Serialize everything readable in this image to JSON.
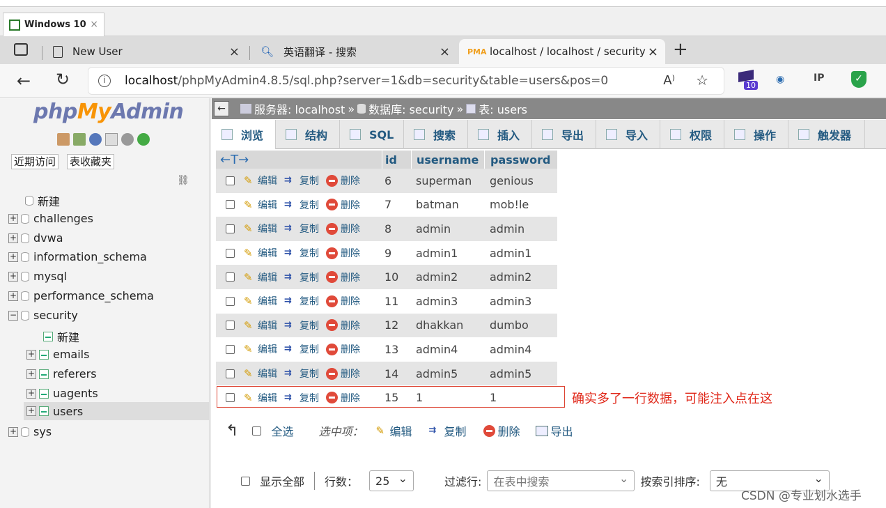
{
  "vm": {
    "tab_title": "Windows 10",
    "close": "×"
  },
  "browser": {
    "tabs": [
      {
        "title": "New User"
      },
      {
        "title": "英语翻译 - 搜索"
      },
      {
        "title": "localhost / localhost / security / u"
      }
    ],
    "new_tab": "+",
    "close_glyph": "×",
    "url_host": "localhost",
    "url_path": "/phpMyAdmin4.8.5/sql.php?server=1&db=security&table=users&pos=0",
    "ext_badge": "10",
    "ext_ip": "IP"
  },
  "nav": {
    "logo_php": "php",
    "logo_my": "My",
    "logo_admin": "Admin",
    "recent_btn": "近期访问",
    "fav_btn": "表收藏夹",
    "tree": [
      {
        "label": "新建",
        "level": 0
      },
      {
        "label": "challenges",
        "level": 0
      },
      {
        "label": "dvwa",
        "level": 0
      },
      {
        "label": "information_schema",
        "level": 0
      },
      {
        "label": "mysql",
        "level": 0
      },
      {
        "label": "performance_schema",
        "level": 0
      },
      {
        "label": "security",
        "level": 0
      },
      {
        "label": "新建",
        "level": 1
      },
      {
        "label": "emails",
        "level": 1
      },
      {
        "label": "referers",
        "level": 1
      },
      {
        "label": "uagents",
        "level": 1
      },
      {
        "label": "users",
        "level": 1
      },
      {
        "label": "sys",
        "level": 0
      }
    ]
  },
  "breadcrumb": {
    "server": "服务器: localhost",
    "sep": "»",
    "database": "数据库: security",
    "table": "表: users"
  },
  "menu": [
    "浏览",
    "结构",
    "SQL",
    "搜索",
    "插入",
    "导出",
    "导入",
    "权限",
    "操作",
    "触发器"
  ],
  "grid": {
    "arrows": "←T→",
    "columns": [
      "id",
      "username",
      "password"
    ],
    "actions": {
      "edit": "编辑",
      "copy": "复制",
      "delete": "删除"
    },
    "rows": [
      {
        "id": "6",
        "username": "superman",
        "password": "genious"
      },
      {
        "id": "7",
        "username": "batman",
        "password": "mob!le"
      },
      {
        "id": "8",
        "username": "admin",
        "password": "admin"
      },
      {
        "id": "9",
        "username": "admin1",
        "password": "admin1"
      },
      {
        "id": "10",
        "username": "admin2",
        "password": "admin2"
      },
      {
        "id": "11",
        "username": "admin3",
        "password": "admin3"
      },
      {
        "id": "12",
        "username": "dhakkan",
        "password": "dumbo"
      },
      {
        "id": "13",
        "username": "admin4",
        "password": "admin4"
      },
      {
        "id": "14",
        "username": "admin5",
        "password": "admin5"
      },
      {
        "id": "15",
        "username": "1",
        "password": "1"
      }
    ]
  },
  "annotation": "确实多了一行数据，可能注入点在这",
  "bulk": {
    "select_all": "全选",
    "with_selected": "选中项：",
    "edit": "编辑",
    "copy": "复制",
    "delete": "删除",
    "export": "导出"
  },
  "bottom": {
    "show_all": "显示全部",
    "rows_label": "行数：",
    "rows_value": "25",
    "filter_label": "过滤行:",
    "filter_placeholder": "在表中搜索",
    "sort_label": "按索引排序:",
    "sort_value": "无"
  },
  "watermark": "CSDN @专业划水选手"
}
